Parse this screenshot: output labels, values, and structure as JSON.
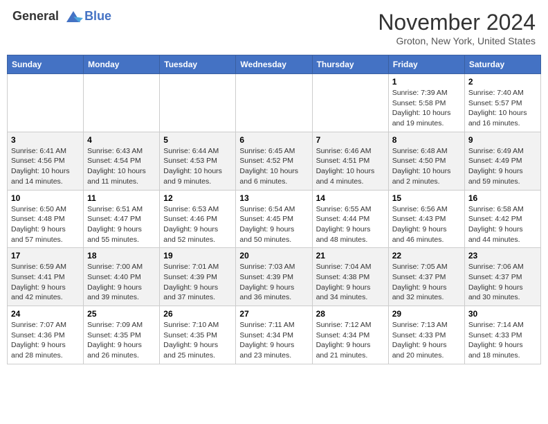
{
  "header": {
    "logo_line1": "General",
    "logo_line2": "Blue",
    "month": "November 2024",
    "location": "Groton, New York, United States"
  },
  "days_of_week": [
    "Sunday",
    "Monday",
    "Tuesday",
    "Wednesday",
    "Thursday",
    "Friday",
    "Saturday"
  ],
  "weeks": [
    [
      {
        "day": "",
        "info": ""
      },
      {
        "day": "",
        "info": ""
      },
      {
        "day": "",
        "info": ""
      },
      {
        "day": "",
        "info": ""
      },
      {
        "day": "",
        "info": ""
      },
      {
        "day": "1",
        "info": "Sunrise: 7:39 AM\nSunset: 5:58 PM\nDaylight: 10 hours and 19 minutes."
      },
      {
        "day": "2",
        "info": "Sunrise: 7:40 AM\nSunset: 5:57 PM\nDaylight: 10 hours and 16 minutes."
      }
    ],
    [
      {
        "day": "3",
        "info": "Sunrise: 6:41 AM\nSunset: 4:56 PM\nDaylight: 10 hours and 14 minutes."
      },
      {
        "day": "4",
        "info": "Sunrise: 6:43 AM\nSunset: 4:54 PM\nDaylight: 10 hours and 11 minutes."
      },
      {
        "day": "5",
        "info": "Sunrise: 6:44 AM\nSunset: 4:53 PM\nDaylight: 10 hours and 9 minutes."
      },
      {
        "day": "6",
        "info": "Sunrise: 6:45 AM\nSunset: 4:52 PM\nDaylight: 10 hours and 6 minutes."
      },
      {
        "day": "7",
        "info": "Sunrise: 6:46 AM\nSunset: 4:51 PM\nDaylight: 10 hours and 4 minutes."
      },
      {
        "day": "8",
        "info": "Sunrise: 6:48 AM\nSunset: 4:50 PM\nDaylight: 10 hours and 2 minutes."
      },
      {
        "day": "9",
        "info": "Sunrise: 6:49 AM\nSunset: 4:49 PM\nDaylight: 9 hours and 59 minutes."
      }
    ],
    [
      {
        "day": "10",
        "info": "Sunrise: 6:50 AM\nSunset: 4:48 PM\nDaylight: 9 hours and 57 minutes."
      },
      {
        "day": "11",
        "info": "Sunrise: 6:51 AM\nSunset: 4:47 PM\nDaylight: 9 hours and 55 minutes."
      },
      {
        "day": "12",
        "info": "Sunrise: 6:53 AM\nSunset: 4:46 PM\nDaylight: 9 hours and 52 minutes."
      },
      {
        "day": "13",
        "info": "Sunrise: 6:54 AM\nSunset: 4:45 PM\nDaylight: 9 hours and 50 minutes."
      },
      {
        "day": "14",
        "info": "Sunrise: 6:55 AM\nSunset: 4:44 PM\nDaylight: 9 hours and 48 minutes."
      },
      {
        "day": "15",
        "info": "Sunrise: 6:56 AM\nSunset: 4:43 PM\nDaylight: 9 hours and 46 minutes."
      },
      {
        "day": "16",
        "info": "Sunrise: 6:58 AM\nSunset: 4:42 PM\nDaylight: 9 hours and 44 minutes."
      }
    ],
    [
      {
        "day": "17",
        "info": "Sunrise: 6:59 AM\nSunset: 4:41 PM\nDaylight: 9 hours and 42 minutes."
      },
      {
        "day": "18",
        "info": "Sunrise: 7:00 AM\nSunset: 4:40 PM\nDaylight: 9 hours and 39 minutes."
      },
      {
        "day": "19",
        "info": "Sunrise: 7:01 AM\nSunset: 4:39 PM\nDaylight: 9 hours and 37 minutes."
      },
      {
        "day": "20",
        "info": "Sunrise: 7:03 AM\nSunset: 4:39 PM\nDaylight: 9 hours and 36 minutes."
      },
      {
        "day": "21",
        "info": "Sunrise: 7:04 AM\nSunset: 4:38 PM\nDaylight: 9 hours and 34 minutes."
      },
      {
        "day": "22",
        "info": "Sunrise: 7:05 AM\nSunset: 4:37 PM\nDaylight: 9 hours and 32 minutes."
      },
      {
        "day": "23",
        "info": "Sunrise: 7:06 AM\nSunset: 4:37 PM\nDaylight: 9 hours and 30 minutes."
      }
    ],
    [
      {
        "day": "24",
        "info": "Sunrise: 7:07 AM\nSunset: 4:36 PM\nDaylight: 9 hours and 28 minutes."
      },
      {
        "day": "25",
        "info": "Sunrise: 7:09 AM\nSunset: 4:35 PM\nDaylight: 9 hours and 26 minutes."
      },
      {
        "day": "26",
        "info": "Sunrise: 7:10 AM\nSunset: 4:35 PM\nDaylight: 9 hours and 25 minutes."
      },
      {
        "day": "27",
        "info": "Sunrise: 7:11 AM\nSunset: 4:34 PM\nDaylight: 9 hours and 23 minutes."
      },
      {
        "day": "28",
        "info": "Sunrise: 7:12 AM\nSunset: 4:34 PM\nDaylight: 9 hours and 21 minutes."
      },
      {
        "day": "29",
        "info": "Sunrise: 7:13 AM\nSunset: 4:33 PM\nDaylight: 9 hours and 20 minutes."
      },
      {
        "day": "30",
        "info": "Sunrise: 7:14 AM\nSunset: 4:33 PM\nDaylight: 9 hours and 18 minutes."
      }
    ]
  ]
}
